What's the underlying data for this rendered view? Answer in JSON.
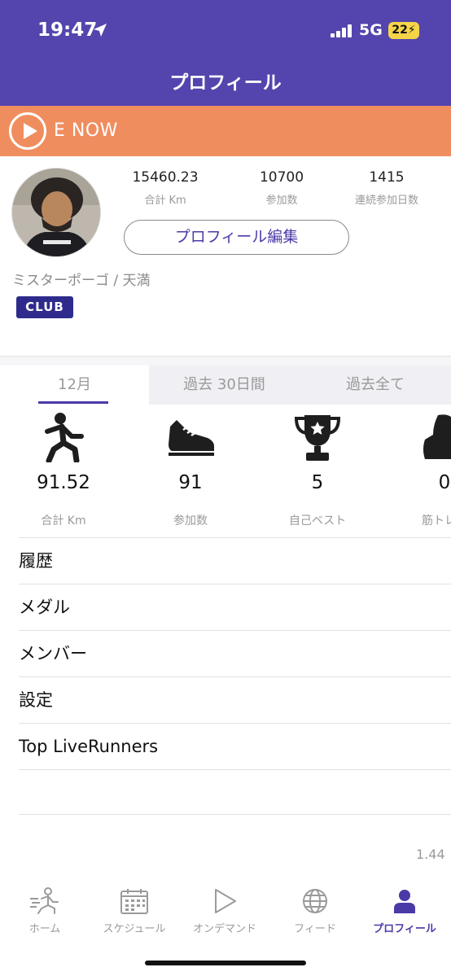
{
  "status_bar": {
    "time": "19:47",
    "network": "5G",
    "battery": "22"
  },
  "header": {
    "title": "プロフィール"
  },
  "banner": {
    "text": "E NOW"
  },
  "profile": {
    "stats": [
      {
        "value": "15460.23",
        "label": "合計 Km"
      },
      {
        "value": "10700",
        "label": "参加数"
      },
      {
        "value": "1415",
        "label": "連続参加日数"
      }
    ],
    "edit_label": "プロフィール編集",
    "username": "ミスターポーゴ / 天満",
    "badge": "CLUB"
  },
  "period_tabs": [
    {
      "label": "12月",
      "active": true
    },
    {
      "label": "過去 30日間",
      "active": false
    },
    {
      "label": "過去全て",
      "active": false
    }
  ],
  "metrics": [
    {
      "icon": "runner-icon",
      "value": "91.52",
      "label": "合計 Km"
    },
    {
      "icon": "shoe-icon",
      "value": "91",
      "label": "参加数"
    },
    {
      "icon": "trophy-icon",
      "value": "5",
      "label": "自己ベスト"
    },
    {
      "icon": "muscle-icon",
      "value": "0",
      "label": "筋トレ参"
    }
  ],
  "menu": [
    {
      "label": "履歴"
    },
    {
      "label": "メダル"
    },
    {
      "label": "メンバー"
    },
    {
      "label": "設定"
    },
    {
      "label": "Top LiveRunners"
    }
  ],
  "version": "1.44",
  "tabbar": [
    {
      "icon": "home-runner-icon",
      "label": "ホーム"
    },
    {
      "icon": "calendar-icon",
      "label": "スケジュール"
    },
    {
      "icon": "play-icon",
      "label": "オンデマンド"
    },
    {
      "icon": "globe-icon",
      "label": "フィード"
    },
    {
      "icon": "person-icon",
      "label": "プロフィール",
      "active": true
    }
  ],
  "colors": {
    "header": "#5345ad",
    "banner": "#f08d5e",
    "accent": "#4a3aa8",
    "badge": "#2e2b8c"
  }
}
